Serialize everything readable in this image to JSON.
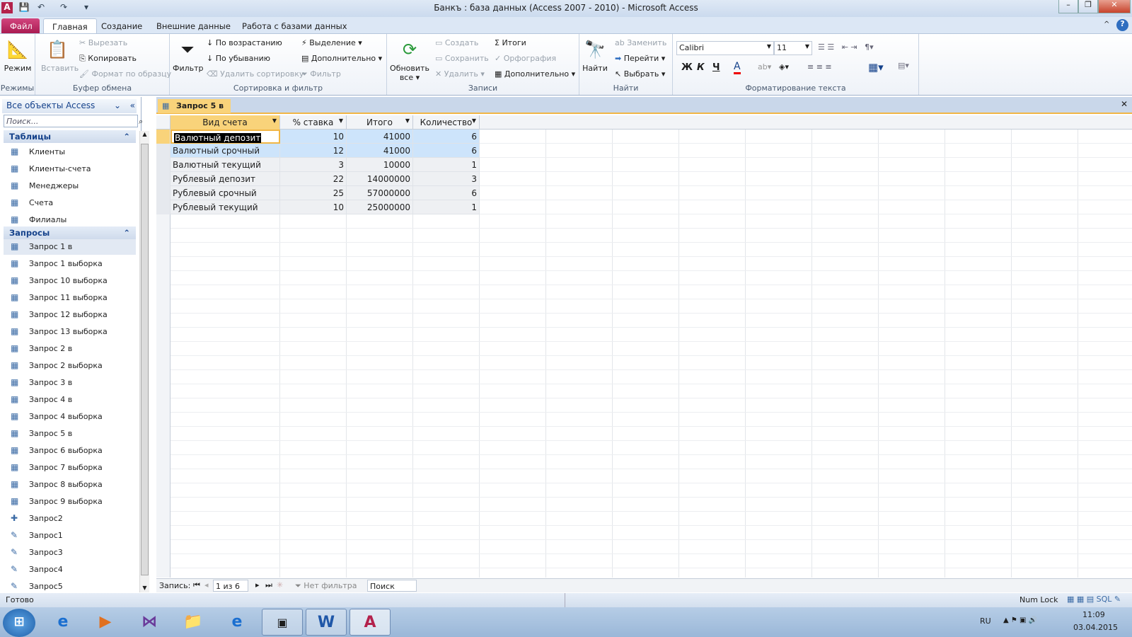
{
  "window": {
    "title": "Банкъ : база данных (Access 2007 - 2010)  -  Microsoft Access"
  },
  "tabs": [
    "Файл",
    "Главная",
    "Создание",
    "Внешние данные",
    "Работа с базами данных"
  ],
  "ribbon": {
    "modes": {
      "label": "Режимы",
      "view": "Режим"
    },
    "clipboard": {
      "label": "Буфер обмена",
      "paste": "Вставить",
      "cut": "Вырезать",
      "copy": "Копировать",
      "format_painter": "Формат по образцу"
    },
    "sort": {
      "label": "Сортировка и фильтр",
      "filter": "Фильтр",
      "ascending": "По возрастанию",
      "descending": "По убыванию",
      "remove_sort": "Удалить сортировку",
      "selection": "Выделение",
      "advanced": "Дополнительно",
      "toggle_filter": "Фильтр"
    },
    "records": {
      "label": "Записи",
      "refresh": "Обновить",
      "refresh2": "все",
      "new": "Создать",
      "save": "Сохранить",
      "delete": "Удалить",
      "totals": "Итоги",
      "spelling": "Орфография",
      "more": "Дополнительно"
    },
    "find": {
      "label": "Найти",
      "find": "Найти",
      "replace": "Заменить",
      "goto": "Перейти",
      "select": "Выбрать"
    },
    "text": {
      "label": "Форматирование текста",
      "font": "Calibri",
      "size": "11",
      "bold": "Ж",
      "italic": "К",
      "underline": "Ч"
    }
  },
  "nav": {
    "title": "Все объекты Access",
    "search_placeholder": "Поиск...",
    "tables_label": "Таблицы",
    "tables": [
      "Клиенты",
      "Клиенты-счета",
      "Менеджеры",
      "Счета",
      "Филиалы"
    ],
    "queries_label": "Запросы",
    "queries": [
      "Запрос 1 в",
      "Запрос 1 выборка",
      "Запрос 10 выборка",
      "Запрос 11 выборка",
      "Запрос 12 выборка",
      "Запрос 13 выборка",
      "Запрос 2 в",
      "Запрос 2 выборка",
      "Запрос 3 в",
      "Запрос 4 в",
      "Запрос 4 выборка",
      "Запрос 5 в",
      "Запрос 6 выборка",
      "Запрос 7 выборка",
      "Запрос 8 выборка",
      "Запрос 9 выборка",
      "Запрос2",
      "Запрос1",
      "Запрос3",
      "Запрос4",
      "Запрос5"
    ]
  },
  "document": {
    "tab": "Запрос 5 в",
    "columns": [
      "Вид счета",
      "% ставка",
      "Итого",
      "Количество"
    ],
    "rows": [
      [
        "Валютный депозит",
        "10",
        "41000",
        "6"
      ],
      [
        "Валютный срочный",
        "12",
        "41000",
        "6"
      ],
      [
        "Валютный текущий",
        "3",
        "10000",
        "1"
      ],
      [
        "Рублевый депозит",
        "22",
        "14000000",
        "3"
      ],
      [
        "Рублевый срочный",
        "25",
        "57000000",
        "6"
      ],
      [
        "Рублевый текущий",
        "10",
        "25000000",
        "1"
      ]
    ]
  },
  "recnav": {
    "label": "Запись:",
    "position": "1 из 6",
    "filter": "Нет фильтра",
    "search": "Поиск"
  },
  "status": {
    "text": "Готово",
    "numlock": "Num Lock"
  },
  "taskbar": {
    "lang": "RU",
    "time": "11:09",
    "date": "03.04.2015"
  }
}
